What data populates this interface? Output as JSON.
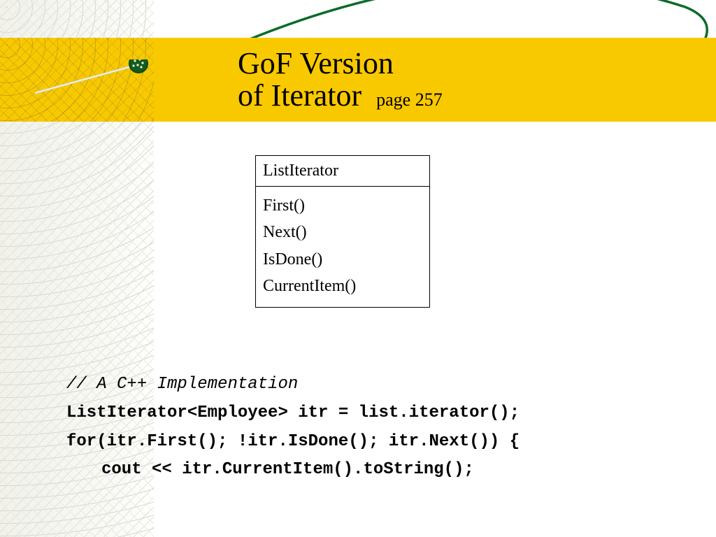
{
  "title": {
    "line1": "GoF Version",
    "line2_main": "of Iterator",
    "page_suffix": "page 257"
  },
  "uml": {
    "class_name": "ListIterator",
    "methods": [
      "First()",
      "Next()",
      "IsDone()",
      "CurrentItem()"
    ]
  },
  "code": {
    "comment": "// A C++ Implementation",
    "line1": "ListIterator<Employee> itr = list.iterator();",
    "line2": "for(itr.First(); !itr.IsDone(); itr.Next()) {",
    "line3": "cout << itr.CurrentItem().toString();"
  },
  "colors": {
    "accent": "#f9c900",
    "swoosh": "#0b6b2b"
  }
}
